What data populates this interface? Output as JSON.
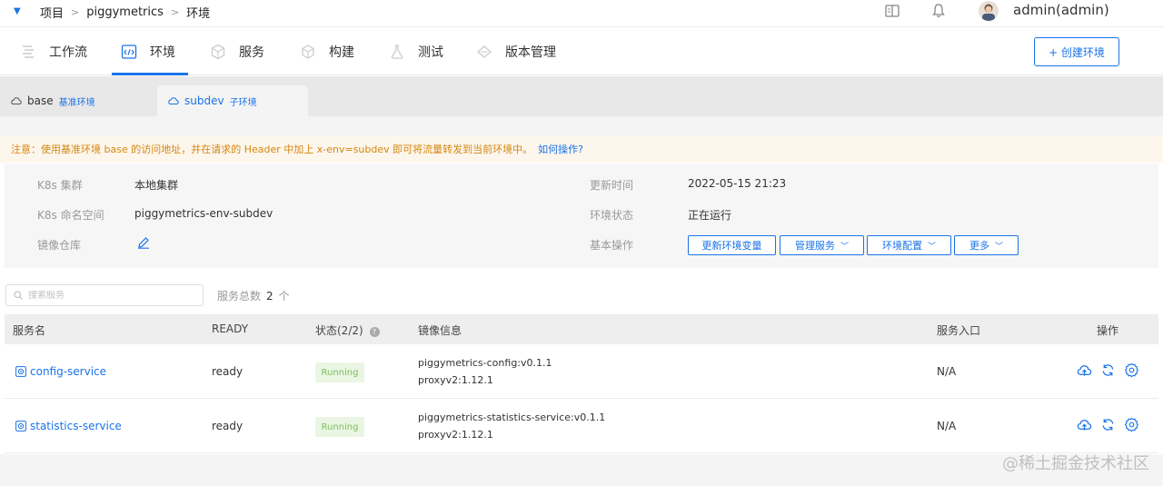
{
  "breadcrumb": {
    "items": [
      "项目",
      "piggymetrics",
      "环境"
    ],
    "separator": ">"
  },
  "user": {
    "name": "admin(admin)"
  },
  "nav": {
    "items": [
      {
        "label": "工作流",
        "icon": "workflow-icon"
      },
      {
        "label": "环境",
        "icon": "code-env-icon",
        "active": true
      },
      {
        "label": "服务",
        "icon": "service-icon"
      },
      {
        "label": "构建",
        "icon": "build-icon"
      },
      {
        "label": "测试",
        "icon": "test-icon"
      },
      {
        "label": "版本管理",
        "icon": "version-icon"
      }
    ],
    "create_button": "+ 创建环境"
  },
  "env_tabs": [
    {
      "name": "base",
      "tag": "基准环境"
    },
    {
      "name": "subdev",
      "tag": "子环境",
      "active": true
    }
  ],
  "notice": {
    "text": "注意：使用基准环境 base 的访问地址，并在请求的 Header 中加上 x-env=subdev 即可将流量转发到当前环境中。",
    "link": "如何操作?"
  },
  "info": {
    "cluster_label": "K8s 集群",
    "cluster_value": "本地集群",
    "namespace_label": "K8s 命名空间",
    "namespace_value": "piggymetrics-env-subdev",
    "registry_label": "镜像仓库",
    "updated_label": "更新时间",
    "updated_value": "2022-05-15 21:23",
    "status_label": "环境状态",
    "status_value": "正在运行",
    "ops_label": "基本操作",
    "ops": [
      "更新环境变量",
      "管理服务",
      "环境配置",
      "更多"
    ]
  },
  "search": {
    "placeholder": "搜索服务"
  },
  "service_count": {
    "label": "服务总数",
    "value": "2",
    "unit": "个"
  },
  "table": {
    "headers": [
      "服务名",
      "READY",
      "状态(2/2)",
      "镜像信息",
      "服务入口",
      "操作"
    ],
    "rows": [
      {
        "name": "config-service",
        "ready": "ready",
        "status": "Running",
        "images": [
          "piggymetrics-config:v0.1.1",
          "proxyv2:1.12.1"
        ],
        "entry": "N/A"
      },
      {
        "name": "statistics-service",
        "ready": "ready",
        "status": "Running",
        "images": [
          "piggymetrics-statistics-service:v0.1.1",
          "proxyv2:1.12.1"
        ],
        "entry": "N/A"
      }
    ]
  },
  "watermark": "@稀土掘金技术社区",
  "colors": {
    "accent": "#1a73e8",
    "running_bg": "#eaf6e3",
    "running_fg": "#7bbf5a",
    "notice_bg": "#fdf6ec",
    "notice_fg": "#d4870f"
  }
}
